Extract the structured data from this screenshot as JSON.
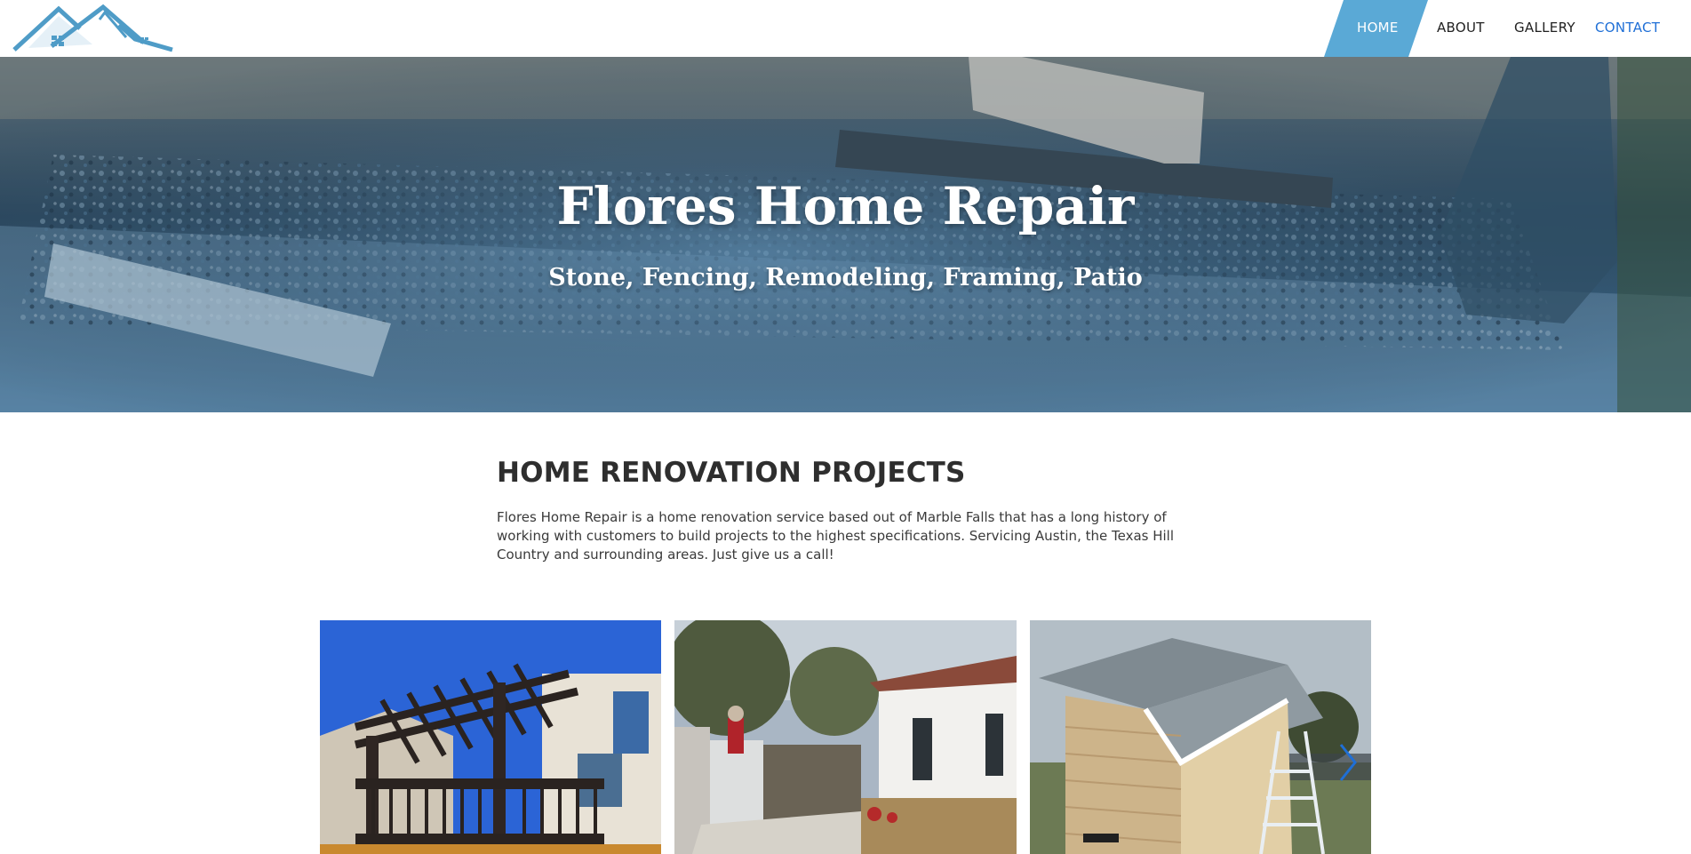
{
  "header": {
    "logo_alt": "Flores Home Repair logo",
    "nav": {
      "home": "HOME",
      "about": "ABOUT",
      "gallery": "GALLERY",
      "contact": "CONTACT"
    },
    "colors": {
      "active_bg": "#5aa9d6",
      "contact": "#1f6fd6",
      "logo": "#4f9cc7"
    }
  },
  "hero": {
    "title": "Flores Home Repair",
    "subtitle": "Stone, Fencing, Remodeling, Framing, Patio"
  },
  "main": {
    "heading": "HOME RENOVATION PROJECTS",
    "body": "Flores Home Repair is a home renovation service based out of Marble Falls that has a long history of working with customers to build projects to the highest specifications. Servicing Austin, the Texas Hill Country and surrounding areas. Just give us a call!"
  },
  "gallery": {
    "images": [
      "pergola-deck-photo",
      "stone-wall-construction-photo",
      "shed-build-photo"
    ],
    "next_icon": "chevron-right-icon"
  }
}
